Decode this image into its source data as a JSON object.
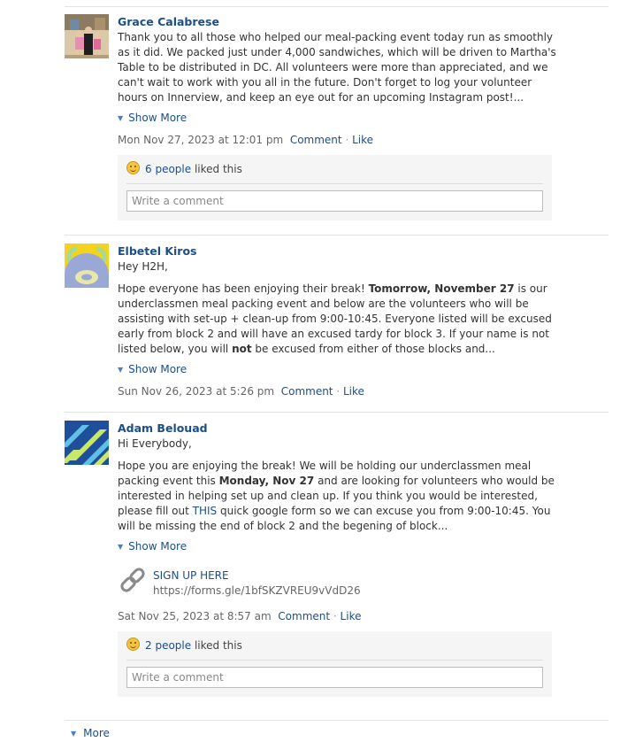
{
  "posts": [
    {
      "author": "Grace Calabrese",
      "paragraphs": [
        [
          {
            "t": "Thank you to all those who helped our meal-packing event today run as smoothly as it did. We packed just under 4,000 sandwiches, which will be driven to Martha's Table to be distributed in DC. All volunteers were more than appreciated, and we can't wait to work with you all in the future. Don't forget to log your volunteer hours on Innerview, and keep an eye out for an upcoming Instagram post!...",
            "b": false
          }
        ]
      ],
      "show_more": "Show More",
      "timestamp": "Mon Nov 27, 2023 at 12:01 pm",
      "comment_label": "Comment",
      "like_label": "Like",
      "likes": {
        "count_text": "6 people",
        "suffix": "liked this"
      },
      "comment_placeholder": "Write a comment"
    },
    {
      "author": "Elbetel Kiros",
      "paragraphs": [
        [
          {
            "t": "Hey H2H,",
            "b": false
          }
        ],
        [
          {
            "t": "Hope everyone has been enjoying their break! ",
            "b": false
          },
          {
            "t": "Tomorrow, November 27",
            "b": true
          },
          {
            "t": " is our underclassmen meal packing event and below are the volunteers who will be assisting with set-up + clean-up from 9:00-10:45. Everyone listed will be excused early from block 2 and will have an excused tardy for block 3. If your name is not listed below, you will ",
            "b": false
          },
          {
            "t": "not",
            "b": true
          },
          {
            "t": " be excused from either of those blocks and...",
            "b": false
          }
        ]
      ],
      "show_more": "Show More",
      "timestamp": "Sun Nov 26, 2023 at 5:26 pm",
      "comment_label": "Comment",
      "like_label": "Like"
    },
    {
      "author": "Adam Belouad",
      "paragraphs": [
        [
          {
            "t": "Hi Everybody,",
            "b": false
          }
        ],
        [
          {
            "t": "Hope you are enjoying the break! We will be holding our underclassmen meal packing event this ",
            "b": false
          },
          {
            "t": "Monday, Nov 27",
            "b": true
          },
          {
            "t": " and are looking for volunteers who would be interested in helping set up and clean up. If you think you would be interested, please fill out ",
            "b": false
          },
          {
            "t": "THIS",
            "b": false,
            "link": true
          },
          {
            "t": " quick google form so we can excuse you from 9:00-10:45. You will be missing the end of block 2 and the begening of block...",
            "b": false
          }
        ]
      ],
      "show_more": "Show More",
      "attachment": {
        "title": "SIGN UP HERE",
        "url": "https://forms.gle/1bfSKZVREU9vVdD26",
        "icon": "link-chain-icon"
      },
      "timestamp": "Sat Nov 25, 2023 at 8:57 am",
      "comment_label": "Comment",
      "like_label": "Like",
      "likes": {
        "count_text": "2 people",
        "suffix": "liked this"
      },
      "comment_placeholder": "Write a comment"
    }
  ],
  "more_label": "More",
  "colors": {
    "link": "#1b4f8a",
    "like_box": "#f5f5f5"
  }
}
